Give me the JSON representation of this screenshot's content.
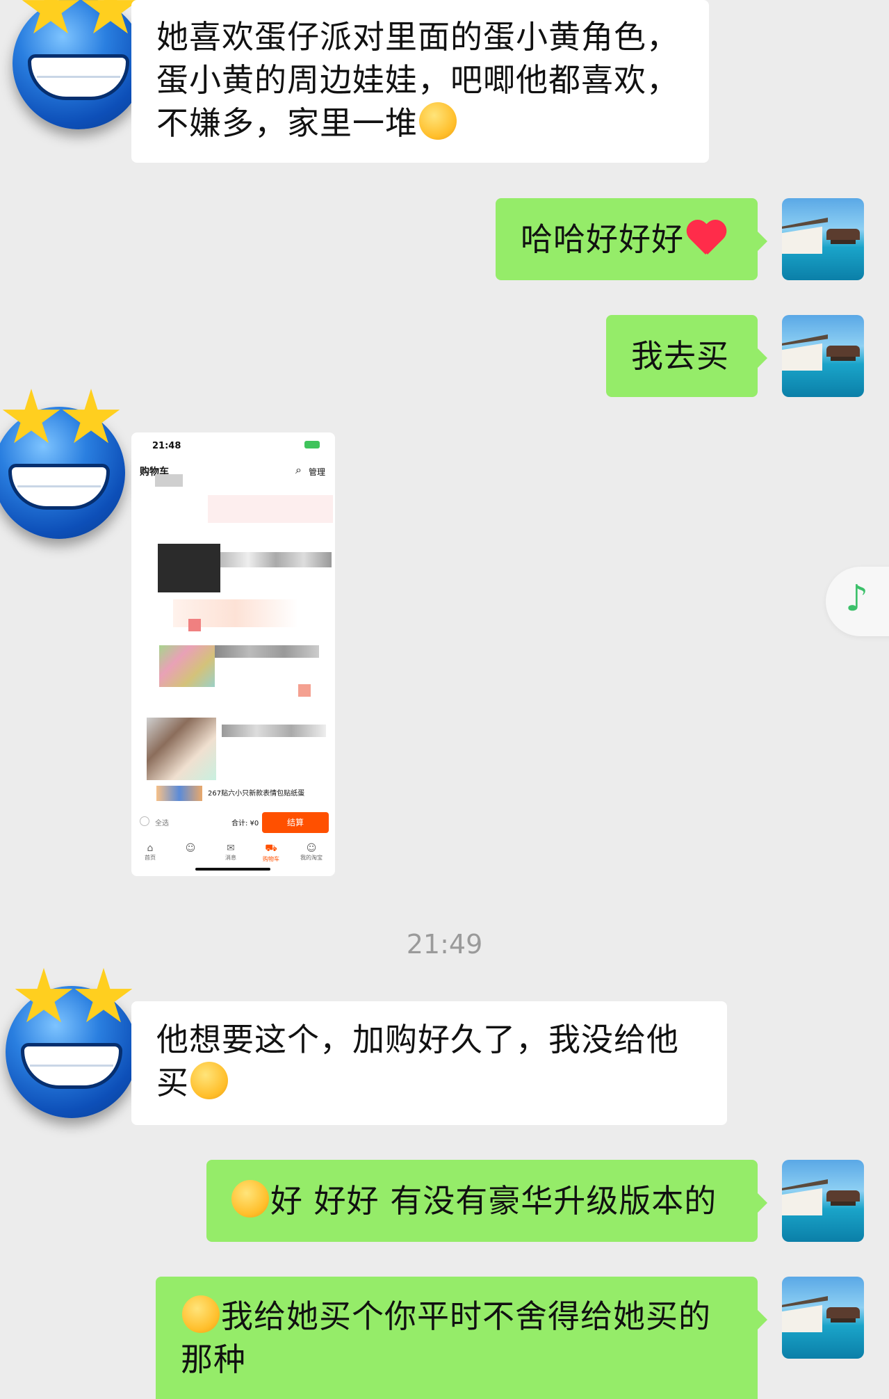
{
  "messages": [
    {
      "side": "in",
      "text": "她喜欢蛋仔派对里面的蛋小黄角色，蛋小黄的周边娃娃，吧唧他都喜欢，不嫌多，家里一堆",
      "emoji": "😭"
    },
    {
      "side": "out",
      "text": "哈哈好好好",
      "emoji": "❤️"
    },
    {
      "side": "out",
      "text": "我去买"
    },
    {
      "side": "in",
      "type": "image"
    },
    {
      "side": "in",
      "text": "他想要这个，加购好久了，我没给他买",
      "emoji": "😭"
    },
    {
      "side": "out",
      "emoji_prefix": "😁",
      "text": "好 好好 有没有豪华升级版本的"
    },
    {
      "side": "out",
      "emoji_prefix": "🤭",
      "text": "我给她买个你平时不舍得给她买的那种"
    }
  ],
  "m1": {
    "line1": "她喜欢蛋仔派对里面的蛋小黄角色，",
    "line2": "蛋小黄的周边娃娃，吧唧他都喜欢，",
    "line3": "不嫌多，家里一堆"
  },
  "m2": {
    "text": "哈哈好好好"
  },
  "m3": {
    "text": "我去买"
  },
  "m5": {
    "line1": "他想要这个，加购好久了，我没给他",
    "line2": "买"
  },
  "m6": {
    "text": "好 好好 有没有豪华升级版本的"
  },
  "m7": {
    "line1": "我给她买个你平时不舍得给她买的",
    "line2": "那种"
  },
  "timestamp": "21:49",
  "screenshot": {
    "status_time": "21:48",
    "battery": "87",
    "title": "购物车",
    "manage": "管理",
    "product_text": "267贴六小只新款表情包贴纸蛋",
    "select_all": "全选",
    "total": "合计: ¥0",
    "checkout": "结算",
    "tabs": [
      "首页",
      "",
      "消息",
      "购物车",
      "我的淘宝"
    ]
  },
  "icons": {
    "music": "music-note-icon"
  },
  "colors": {
    "out_bubble": "#95ec69",
    "in_bubble": "#ffffff",
    "background": "#ececec",
    "accent": "#ff5000"
  }
}
